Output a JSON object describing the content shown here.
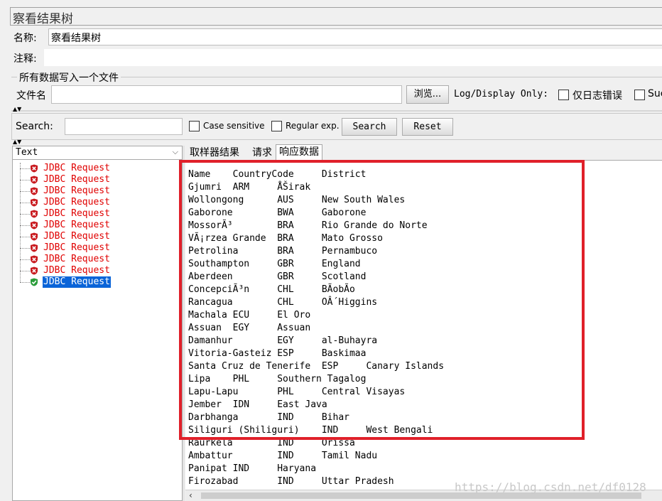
{
  "window": {
    "title": "察看结果树"
  },
  "form": {
    "name_label": "名称:",
    "name_value": "察看结果树",
    "comment_label": "注释:"
  },
  "file_group": {
    "title": "所有数据写入一个文件",
    "filename_label": "文件名",
    "filename_value": "",
    "browse_label": "浏览...",
    "logdisplay_label": "Log/Display Only:",
    "errors_only_label": "仅日志错误",
    "success_label": "Suc"
  },
  "search_bar": {
    "label": "Search:",
    "value": "",
    "case_label": "Case sensitive",
    "regex_label": "Regular exp.",
    "search_button": "Search",
    "reset_button": "Reset"
  },
  "renderer": {
    "selected": "Text"
  },
  "tree": {
    "items": [
      {
        "label": "JDBC Request",
        "status": "error"
      },
      {
        "label": "JDBC Request",
        "status": "error"
      },
      {
        "label": "JDBC Request",
        "status": "error"
      },
      {
        "label": "JDBC Request",
        "status": "error"
      },
      {
        "label": "JDBC Request",
        "status": "error"
      },
      {
        "label": "JDBC Request",
        "status": "error"
      },
      {
        "label": "JDBC Request",
        "status": "error"
      },
      {
        "label": "JDBC Request",
        "status": "error"
      },
      {
        "label": "JDBC Request",
        "status": "error"
      },
      {
        "label": "JDBC Request",
        "status": "error"
      },
      {
        "label": "JDBC Request",
        "status": "success"
      }
    ]
  },
  "tabs": [
    {
      "label": "取样器结果"
    },
    {
      "label": "请求"
    },
    {
      "label": "响应数据"
    }
  ],
  "response": {
    "lines": [
      "Name\tCountryCode\tDistrict",
      "Gjumri\tARM\tÅŠirak",
      "Wollongong\tAUS\tNew South Wales",
      "Gaborone\tBWA\tGaborone",
      "MossorÃ³\tBRA\tRio Grande do Norte",
      "VÃ¡rzea Grande\tBRA\tMato Grosso",
      "Petrolina\tBRA\tPernambuco",
      "Southampton\tGBR\tEngland",
      "Aberdeen\tGBR\tScotland",
      "ConcepciÃ³n\tCHL\tBÃ­obÃ­o",
      "Rancagua\tCHL\tOÂ´Higgins",
      "Machala\tECU\tEl Oro",
      "Assuan\tEGY\tAssuan",
      "Damanhur\tEGY\tal-Buhayra",
      "Vitoria-Gasteiz\tESP\tBaskimaa",
      "Santa Cruz de Tenerife\tESP\tCanary Islands",
      "Lipa\tPHL\tSouthern Tagalog",
      "Lapu-Lapu\tPHL\tCentral Visayas",
      "Jember\tIDN\tEast Java",
      "Darbhanga\tIND\tBihar",
      "Siliguri (Shiliguri)\tIND\tWest Bengali",
      "Raurkela\tIND\tOrissa",
      "Ambattur\tIND\tTamil Nadu",
      "Panipat\tIND\tHaryana",
      "Firozabad\tIND\tUttar Pradesh"
    ]
  },
  "watermark": "https://blog.csdn.net/df0128",
  "colors": {
    "highlight_box": "#e0202a",
    "error_text": "#e00000",
    "selection": "#0a64d8"
  }
}
